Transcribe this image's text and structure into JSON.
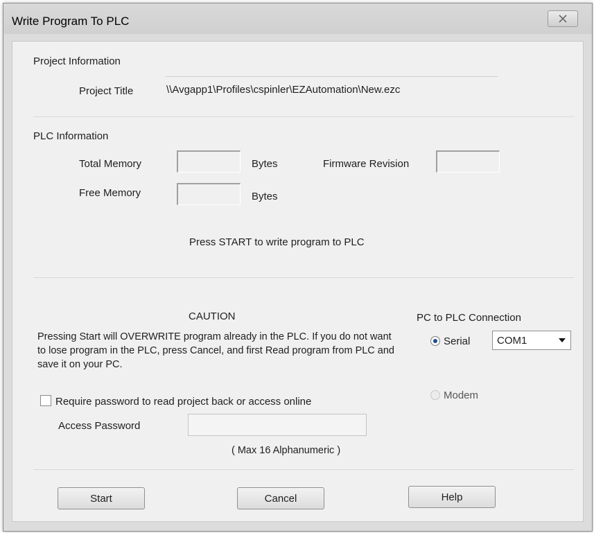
{
  "window": {
    "title": "Write Program To PLC"
  },
  "project": {
    "section_label": "Project Information",
    "title_label": "Project Title",
    "title_value": "\\\\Avgapp1\\Profiles\\cspinler\\EZAutomation\\New.ezc"
  },
  "plc": {
    "section_label": "PLC Information",
    "total_memory_label": "Total Memory",
    "free_memory_label": "Free Memory",
    "bytes_label_1": "Bytes",
    "bytes_label_2": "Bytes",
    "firmware_label": "Firmware Revision",
    "total_memory_value": "",
    "free_memory_value": "",
    "firmware_value": ""
  },
  "instructions": {
    "press_start": "Press START to write program to PLC"
  },
  "caution": {
    "title": "CAUTION",
    "text": "Pressing Start will OVERWRITE program already in the PLC. If you do not want to lose program in the PLC, press Cancel, and first Read program from PLC and save it on your PC."
  },
  "connection": {
    "label": "PC to PLC Connection",
    "serial_label": "Serial",
    "modem_label": "Modem",
    "serial_selected": true,
    "port_value": "COM1"
  },
  "password": {
    "require_label": "Require password to read project back or access online",
    "require_checked": false,
    "access_label": "Access Password",
    "access_value": "",
    "hint": "( Max 16 Alphanumeric )"
  },
  "buttons": {
    "start": "Start",
    "cancel": "Cancel",
    "help": "Help"
  },
  "colors": {
    "client_bg": "#f0f0f0",
    "frame_bg": "#dcdcdc",
    "radio_dot": "#1c4d8f"
  },
  "icons": {
    "close": "close-icon",
    "dropdown": "chevron-down-icon"
  }
}
